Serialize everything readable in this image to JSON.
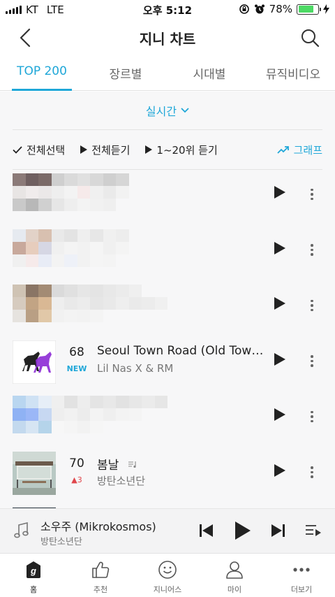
{
  "status_bar": {
    "carrier": "KT",
    "network": "LTE",
    "time": "오후 5:12",
    "battery_text": "78%",
    "battery_level": 0.78
  },
  "header": {
    "title": "지니 차트"
  },
  "tabs": [
    {
      "label": "TOP 200",
      "active": true
    },
    {
      "label": "장르별",
      "active": false
    },
    {
      "label": "시대별",
      "active": false
    },
    {
      "label": "뮤직비디오",
      "active": false
    }
  ],
  "filter": {
    "label": "실시간"
  },
  "actions": {
    "select_all": "전체선택",
    "play_all": "전체듣기",
    "play_range": "1~20위 듣기",
    "graph": "그래프"
  },
  "songs": [
    {
      "rank": "",
      "change": "",
      "title": "",
      "artist": "",
      "blurred": true
    },
    {
      "rank": "",
      "change": "",
      "title": "",
      "artist": "",
      "blurred": true
    },
    {
      "rank": "",
      "change": "",
      "title": "",
      "artist": "",
      "blurred": true
    },
    {
      "rank": "68",
      "change": "NEW",
      "title": "Seoul Town Road (Old Town Road Remix)",
      "artist": "Lil Nas X & RM",
      "blurred": false
    },
    {
      "rank": "",
      "change": "",
      "title": "",
      "artist": "",
      "blurred": true
    },
    {
      "rank": "70",
      "change": "▲3",
      "title": "봄날",
      "artist": "방탄소년단",
      "blurred": false
    }
  ],
  "player": {
    "title": "소우주 (Mikrokosmos)",
    "artist": "방탄소년단"
  },
  "nav": [
    {
      "label": "홈",
      "icon": "home-g-icon",
      "active": true
    },
    {
      "label": "추천",
      "icon": "thumbs-up-icon",
      "active": false
    },
    {
      "label": "지니어스",
      "icon": "smiley-icon",
      "active": false
    },
    {
      "label": "마이",
      "icon": "person-icon",
      "active": false
    },
    {
      "label": "더보기",
      "icon": "more-dots-icon",
      "active": false
    }
  ],
  "colors": {
    "accent": "#1fa7d8",
    "rank_up": "#e0474c",
    "battery": "#4cd964"
  }
}
